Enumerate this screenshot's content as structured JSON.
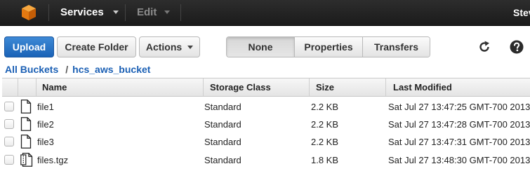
{
  "nav": {
    "services_label": "Services",
    "edit_label": "Edit",
    "user_label": "Steve"
  },
  "toolbar": {
    "upload_label": "Upload",
    "create_folder_label": "Create Folder",
    "actions_label": "Actions",
    "view_tabs": [
      {
        "label": "None",
        "active": true
      },
      {
        "label": "Properties",
        "active": false
      },
      {
        "label": "Transfers",
        "active": false
      }
    ],
    "refresh_icon": "refresh-icon",
    "help_icon": "help-icon"
  },
  "breadcrumb": {
    "root_label": "All Buckets",
    "separator": "/",
    "bucket_label": "hcs_aws_bucket"
  },
  "table": {
    "columns": [
      "Name",
      "Storage Class",
      "Size",
      "Last Modified"
    ],
    "rows": [
      {
        "icon": "file-icon",
        "name": "file1",
        "storage_class": "Standard",
        "size": "2.2 KB",
        "modified": "Sat Jul 27 13:47:25 GMT-700 2013"
      },
      {
        "icon": "file-icon",
        "name": "file2",
        "storage_class": "Standard",
        "size": "2.2 KB",
        "modified": "Sat Jul 27 13:47:28 GMT-700 2013"
      },
      {
        "icon": "file-icon",
        "name": "file3",
        "storage_class": "Standard",
        "size": "2.2 KB",
        "modified": "Sat Jul 27 13:47:31 GMT-700 2013"
      },
      {
        "icon": "archive-file-icon",
        "name": "files.tgz",
        "storage_class": "Standard",
        "size": "1.8 KB",
        "modified": "Sat Jul 27 13:48:30 GMT-700 2013"
      }
    ]
  },
  "colors": {
    "nav_bg": "#222222",
    "primary_button": "#2a74c6",
    "link_blue": "#1a5fb4",
    "logo_orange": "#f7981d"
  }
}
